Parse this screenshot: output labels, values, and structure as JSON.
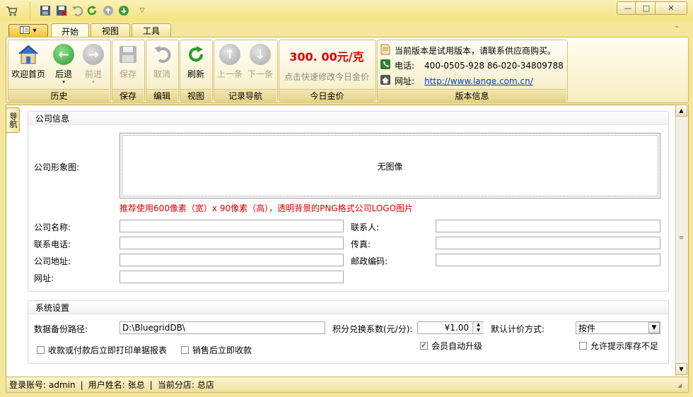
{
  "qat": {
    "icons": [
      "cart-icon",
      "save-icon",
      "save-close-icon",
      "undo-icon",
      "refresh-icon",
      "up-icon",
      "down-icon",
      "customize-icon"
    ]
  },
  "window": {
    "minimize": "—",
    "maximize": "□",
    "close": "✕"
  },
  "tabs": [
    {
      "label": "开始",
      "active": true
    },
    {
      "label": "视图",
      "active": false
    },
    {
      "label": "工具",
      "active": false
    }
  ],
  "ribbon": {
    "history": {
      "label": "历史",
      "welcome": "欢迎首页",
      "back": "后退",
      "forward": "前进"
    },
    "save": {
      "label": "保存",
      "save": "保存"
    },
    "edit": {
      "label": "编辑",
      "cancel": "取消"
    },
    "view": {
      "label": "视图",
      "refresh": "刷新"
    },
    "nav": {
      "label": "记录导航",
      "prev": "上一条",
      "next": "下一条"
    },
    "gold": {
      "label": "今日金价",
      "price": "300. 00元/克",
      "hint": "点击快速修改今日金价"
    },
    "version": {
      "label": "版本信息",
      "notice": "当前版本是试用版本，请联系供应商购买。",
      "phone_label": "电话:",
      "phone": "400-0505-928  86-020-34809788",
      "site_label": "网址:",
      "site": "http://www.lange.com.cn/"
    }
  },
  "sidetab": {
    "label": "导航"
  },
  "company": {
    "legend": "公司信息",
    "image_label": "公司形象图:",
    "no_image": "无图像",
    "image_hint": "推荐使用600像素（宽）x 90像素（高），透明背景的PNG格式公司LOGO图片",
    "name_label": "公司名称:",
    "name_value": "",
    "contact_label": "联系人:",
    "contact_value": "",
    "phone_label": "联系电话:",
    "phone_value": "",
    "fax_label": "传真:",
    "fax_value": "",
    "address_label": "公司地址:",
    "address_value": "",
    "zip_label": "邮政编码:",
    "zip_value": "",
    "website_label": "网址:",
    "website_value": ""
  },
  "system": {
    "legend": "系统设置",
    "backup_label": "数据备份路径:",
    "backup_value": "D:\\BluegridDB\\",
    "points_label": "积分兑换系数(元/分):",
    "points_value": "¥1.00",
    "pricing_label": "默认计价方式:",
    "pricing_value": "按件",
    "print_receipt": {
      "label": "收款或付款后立即打印单据报表",
      "checked": false
    },
    "collect_after_sale": {
      "label": "销售后立即收款",
      "checked": false
    },
    "auto_upgrade": {
      "label": "会员自动升级",
      "checked": true
    },
    "stock_warning": {
      "label": "允许提示库存不足",
      "checked": false
    }
  },
  "status": {
    "account_label": "登录账号:",
    "account": "admin",
    "user_label": "用户姓名:",
    "user": "张总",
    "branch_label": "当前分店:",
    "branch": "总店"
  }
}
